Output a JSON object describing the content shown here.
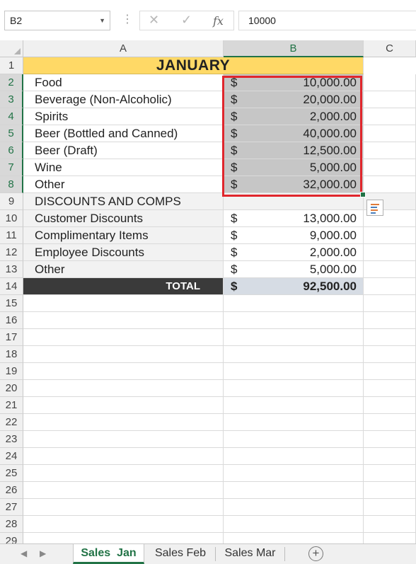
{
  "formula_bar": {
    "name_box": "B2",
    "cancel_icon": "✕",
    "enter_icon": "✓",
    "fx_label": "fx",
    "value": "10000"
  },
  "columns": [
    "A",
    "B",
    "C"
  ],
  "selected_column": "B",
  "rows": [
    {
      "num": "1",
      "a": "JANUARY",
      "dollar": "",
      "amount": ""
    },
    {
      "num": "2",
      "a": "Food",
      "dollar": "$",
      "amount": "10,000.00"
    },
    {
      "num": "3",
      "a": "Beverage (Non-Alcoholic)",
      "dollar": "$",
      "amount": "20,000.00"
    },
    {
      "num": "4",
      "a": "Spirits",
      "dollar": "$",
      "amount": "2,000.00"
    },
    {
      "num": "5",
      "a": "Beer (Bottled and Canned)",
      "dollar": "$",
      "amount": "40,000.00"
    },
    {
      "num": "6",
      "a": "Beer (Draft)",
      "dollar": "$",
      "amount": "12,500.00"
    },
    {
      "num": "7",
      "a": "Wine",
      "dollar": "$",
      "amount": "5,000.00"
    },
    {
      "num": "8",
      "a": "Other",
      "dollar": "$",
      "amount": "32,000.00"
    },
    {
      "num": "9",
      "a": "DISCOUNTS AND COMPS",
      "dollar": "",
      "amount": ""
    },
    {
      "num": "10",
      "a": "Customer Discounts",
      "dollar": "$",
      "amount": "13,000.00"
    },
    {
      "num": "11",
      "a": "Complimentary Items",
      "dollar": "$",
      "amount": "9,000.00"
    },
    {
      "num": "12",
      "a": "Employee Discounts",
      "dollar": "$",
      "amount": "2,000.00"
    },
    {
      "num": "13",
      "a": "Other",
      "dollar": "$",
      "amount": "5,000.00"
    },
    {
      "num": "14",
      "a": "TOTAL",
      "dollar": "$",
      "amount": "92,500.00"
    }
  ],
  "empty_rows": [
    "15",
    "16",
    "17",
    "18",
    "19",
    "20",
    "21",
    "22",
    "23",
    "24",
    "25",
    "26",
    "27",
    "28",
    "29"
  ],
  "sheet_tabs": [
    {
      "label": "Sales  Jan",
      "active": true
    },
    {
      "label": "Sales Feb",
      "active": false
    },
    {
      "label": "Sales Mar",
      "active": false
    }
  ],
  "add_sheet_label": "+",
  "colors": {
    "title_fill": "#ffd966",
    "total_fill": "#3a3a3a",
    "total_value_fill": "#d6dce4",
    "selection_fill": "#c6c6c6",
    "highlight_border": "#e0262c",
    "excel_green": "#217346"
  }
}
